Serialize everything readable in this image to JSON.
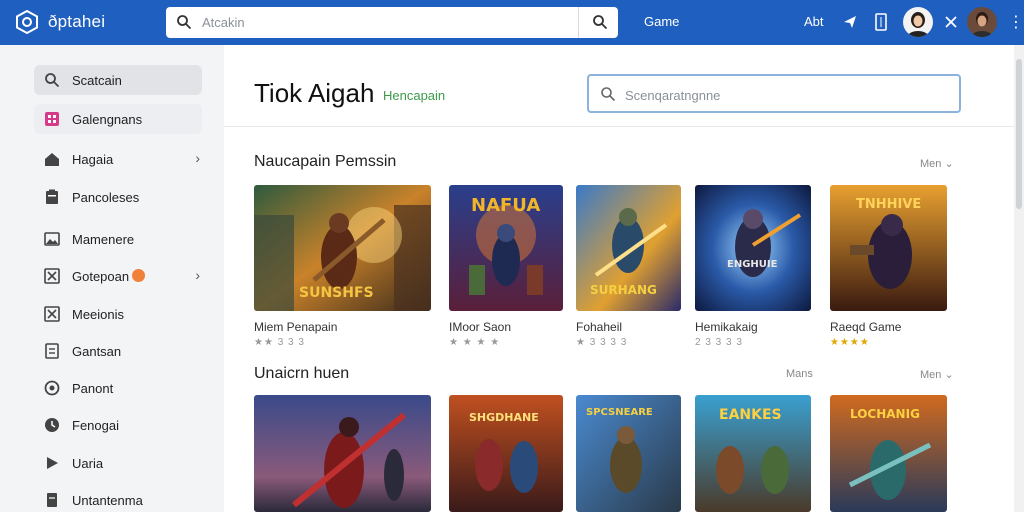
{
  "topbar": {
    "brand": "ðptahei",
    "search_placeholder": "Atcakin",
    "nav_games": "Game",
    "nav_about": "Abt"
  },
  "sidebar": {
    "items": [
      {
        "label": "Scatcain",
        "icon": "search-icon"
      },
      {
        "label": "Galengnans",
        "icon": "grid-icon"
      },
      {
        "label": "Hagaia",
        "icon": "home-icon"
      },
      {
        "label": "Pancoleses",
        "icon": "clipboard-icon"
      },
      {
        "label": "Mamenere",
        "icon": "image-icon"
      },
      {
        "label": "Gotepoan",
        "icon": "close-box-icon"
      },
      {
        "label": "Meeionis",
        "icon": "close-box-icon"
      },
      {
        "label": "Gantsan",
        "icon": "doc-icon"
      },
      {
        "label": "Panont",
        "icon": "record-icon"
      },
      {
        "label": "Fenogai",
        "icon": "clock-icon"
      },
      {
        "label": "Uaria",
        "icon": "play-icon"
      },
      {
        "label": "Untantenma",
        "icon": "doc-icon"
      }
    ]
  },
  "main": {
    "title": "Tiok Aigah",
    "subtitle": "Hencapain",
    "filter_placeholder": "Scenqaratngnne",
    "section1": {
      "title": "Naucapain Pemssin",
      "more": "Men",
      "cards": [
        {
          "name": "Miem Penapain",
          "rating": "★★ 3 3 3",
          "art_text": "SUNSHFS"
        },
        {
          "name": "IMoor Saon",
          "rating": "★ ★ ★ ★",
          "art_text": "NAFUA"
        },
        {
          "name": "Fohaheil",
          "rating": "★ 3 3 3 3",
          "art_text": "SURHANG"
        },
        {
          "name": "Hemikakaig",
          "rating": "2 3 3 3 3",
          "art_text": "ENGHUIE"
        },
        {
          "name": "Raeqd Game",
          "rating": "★★★★",
          "art_text": "TNHHIVE"
        }
      ]
    },
    "section2": {
      "title": "Unaicrn huen",
      "more_a": "Mans",
      "more_b": "Men",
      "cards": [
        {
          "art_text": ""
        },
        {
          "art_text": "SHGDHANE"
        },
        {
          "art_text": "SPCSNEARE"
        },
        {
          "art_text": "EANKES"
        },
        {
          "art_text": "LOCHANIG"
        }
      ]
    }
  },
  "colors": {
    "topbar": "#1f5fc0",
    "accent_green": "#3c9a4a",
    "filter_border": "#8bb3dd"
  }
}
